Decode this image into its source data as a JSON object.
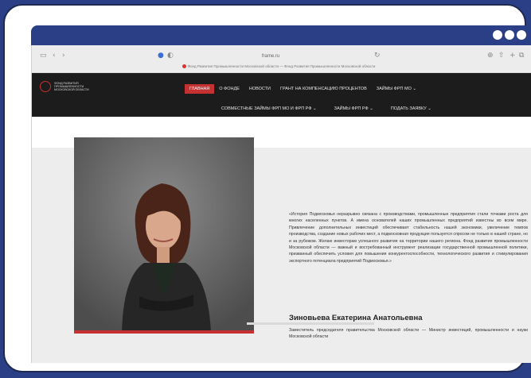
{
  "browser": {
    "address": "frame.ru",
    "tab_title": "Фонд Развития Промышленности Московской области — Фонд Развития Промышленности Московской области"
  },
  "site": {
    "logo_text": "ФОНД РАЗВИТИЯ ПРОМЫШЛЕННОСТИ МОСКОВСКОЙ ОБЛАСТИ",
    "menu_row1": [
      "ГЛАВНАЯ",
      "О ФОНДЕ",
      "НОВОСТИ",
      "ГРАНТ НА КОМПЕНСАЦИЮ ПРОЦЕНТОВ",
      "ЗАЙМЫ ФРП МО ⌄"
    ],
    "menu_row2": [
      "СОВМЕСТНЫЕ ЗАЙМЫ ФРП МО И ФРП РФ ⌄",
      "ЗАЙМЫ ФРП РФ ⌄",
      "ПОДАТЬ ЗАЯВКУ ⌄"
    ]
  },
  "content": {
    "quote": "«История Подмосковья неразрывно связана с производствами, промышленные предприятия стали точками роста для многих населенных пунктов. А имена основателей наших промышленных предприятий известны во всем мире. Привлечение дополнительных инвестиций обеспечивает стабильность нашей экономики, увеличение темпов производства, создание новых рабочих мест, а подмосковная продукция пользуется спросом не только в нашей стране, но и за рубежом. Желаю инвесторам успешного развития на территории нашего региона. Фонд развития промышленности Московской области — важный и востребованный инструмент реализации государственной промышленной политики, призванный обеспечить условия для повышения конкурентоспособности, технологического развития и стимулирования экспортного потенциала предприятий Подмосковья.»",
    "name": "Зиновьева Екатерина Анатольевна",
    "role": "Заместитель председателя правительства Московской области — Министр инвестиций, промышленности и науки Московской области"
  },
  "colors": {
    "accent": "#c53030",
    "frame": "#2b3f87",
    "nav": "#1c1c1c"
  }
}
